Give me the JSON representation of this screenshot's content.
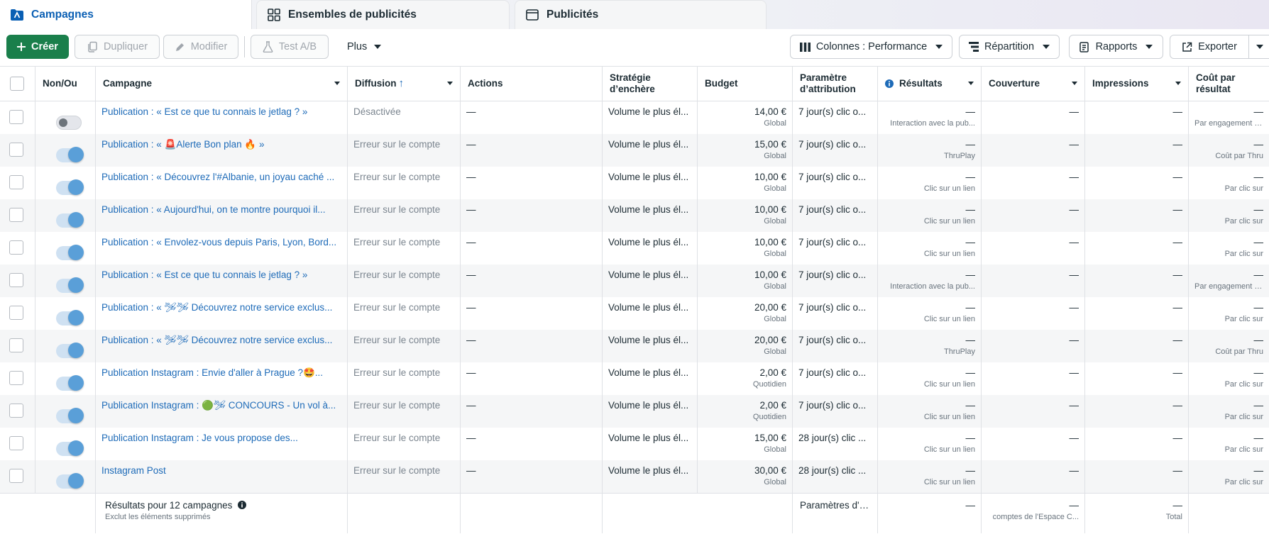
{
  "tabs": [
    {
      "label": "Campagnes",
      "icon": "folder-icon",
      "active": true
    },
    {
      "label": "Ensembles de publicités",
      "icon": "grid-icon",
      "active": false
    },
    {
      "label": "Publicités",
      "icon": "window-icon",
      "active": false
    }
  ],
  "toolbar": {
    "create": "Créer",
    "duplicate": "Dupliquer",
    "edit": "Modifier",
    "abtest": "Test A/B",
    "more": "Plus",
    "columns": "Colonnes : Performance",
    "breakdown": "Répartition",
    "reports": "Rapports",
    "export": "Exporter"
  },
  "headers": {
    "onoff": "Non/Ou",
    "campaign": "Campagne",
    "delivery": "Diffusion",
    "actions": "Actions",
    "bid": "Stratégie d’enchère",
    "budget": "Budget",
    "attribution": "Paramètre d’attribution",
    "results": "Résultats",
    "reach": "Couverture",
    "impressions": "Impressions",
    "cost": "Coût par résultat"
  },
  "rows": [
    {
      "on": false,
      "name": "Publication : « Est ce que tu connais le jetlag ? »",
      "delivery": "Désactivée",
      "actions": "—",
      "bid": "Volume le plus él...",
      "budget": "14,00 €",
      "budget_type": "Global",
      "attribution": "7 jour(s) clic o...",
      "results": "—",
      "result_type": "Interaction avec la pub...",
      "reach": "—",
      "impressions": "—",
      "cost": "—",
      "cost_type": "Par engagement ave"
    },
    {
      "on": true,
      "name": "Publication : « 🚨Alerte Bon plan 🔥 »",
      "delivery": "Erreur sur le compte",
      "actions": "—",
      "bid": "Volume le plus él...",
      "budget": "15,00 €",
      "budget_type": "Global",
      "attribution": "7 jour(s) clic o...",
      "results": "—",
      "result_type": "ThruPlay",
      "reach": "—",
      "impressions": "—",
      "cost": "—",
      "cost_type": "Coût par Thru"
    },
    {
      "on": true,
      "name": "Publication : « Découvrez l'#Albanie, un joyau caché ...",
      "delivery": "Erreur sur le compte",
      "actions": "—",
      "bid": "Volume le plus él...",
      "budget": "10,00 €",
      "budget_type": "Global",
      "attribution": "7 jour(s) clic o...",
      "results": "—",
      "result_type": "Clic sur un lien",
      "reach": "—",
      "impressions": "—",
      "cost": "—",
      "cost_type": "Par clic sur"
    },
    {
      "on": true,
      "name": "Publication : « Aujourd'hui, on te montre pourquoi il...",
      "delivery": "Erreur sur le compte",
      "actions": "—",
      "bid": "Volume le plus él...",
      "budget": "10,00 €",
      "budget_type": "Global",
      "attribution": "7 jour(s) clic o...",
      "results": "—",
      "result_type": "Clic sur un lien",
      "reach": "—",
      "impressions": "—",
      "cost": "—",
      "cost_type": "Par clic sur"
    },
    {
      "on": true,
      "name": "Publication : « Envolez-vous depuis Paris, Lyon, Bord...",
      "delivery": "Erreur sur le compte",
      "actions": "—",
      "bid": "Volume le plus él...",
      "budget": "10,00 €",
      "budget_type": "Global",
      "attribution": "7 jour(s) clic o...",
      "results": "—",
      "result_type": "Clic sur un lien",
      "reach": "—",
      "impressions": "—",
      "cost": "—",
      "cost_type": "Par clic sur"
    },
    {
      "on": true,
      "name": "Publication : « Est ce que tu connais le jetlag ? »",
      "delivery": "Erreur sur le compte",
      "actions": "—",
      "bid": "Volume le plus él...",
      "budget": "10,00 €",
      "budget_type": "Global",
      "attribution": "7 jour(s) clic o...",
      "results": "—",
      "result_type": "Interaction avec la pub...",
      "reach": "—",
      "impressions": "—",
      "cost": "—",
      "cost_type": "Par engagement ave"
    },
    {
      "on": true,
      "name": "Publication : « 🛩🛩 Découvrez notre service exclus...",
      "delivery": "Erreur sur le compte",
      "actions": "—",
      "bid": "Volume le plus él...",
      "budget": "20,00 €",
      "budget_type": "Global",
      "attribution": "7 jour(s) clic o...",
      "results": "—",
      "result_type": "Clic sur un lien",
      "reach": "—",
      "impressions": "—",
      "cost": "—",
      "cost_type": "Par clic sur"
    },
    {
      "on": true,
      "name": "Publication : « 🛩🛩 Découvrez notre service exclus...",
      "delivery": "Erreur sur le compte",
      "actions": "—",
      "bid": "Volume le plus él...",
      "budget": "20,00 €",
      "budget_type": "Global",
      "attribution": "7 jour(s) clic o...",
      "results": "—",
      "result_type": "ThruPlay",
      "reach": "—",
      "impressions": "—",
      "cost": "—",
      "cost_type": "Coût par Thru"
    },
    {
      "on": true,
      "name": "Publication Instagram : Envie d'aller à Prague ?🤩...",
      "delivery": "Erreur sur le compte",
      "actions": "—",
      "bid": "Volume le plus él...",
      "budget": "2,00 €",
      "budget_type": "Quotidien",
      "attribution": "7 jour(s) clic o...",
      "results": "—",
      "result_type": "Clic sur un lien",
      "reach": "—",
      "impressions": "—",
      "cost": "—",
      "cost_type": "Par clic sur"
    },
    {
      "on": true,
      "name": "Publication Instagram : 🟢🛩 CONCOURS - Un vol à...",
      "delivery": "Erreur sur le compte",
      "actions": "—",
      "bid": "Volume le plus él...",
      "budget": "2,00 €",
      "budget_type": "Quotidien",
      "attribution": "7 jour(s) clic o...",
      "results": "—",
      "result_type": "Clic sur un lien",
      "reach": "—",
      "impressions": "—",
      "cost": "—",
      "cost_type": "Par clic sur"
    },
    {
      "on": true,
      "name": "Publication Instagram : Je vous propose des...",
      "delivery": "Erreur sur le compte",
      "actions": "—",
      "bid": "Volume le plus él...",
      "budget": "15,00 €",
      "budget_type": "Global",
      "attribution": "28 jour(s) clic ...",
      "results": "—",
      "result_type": "Clic sur un lien",
      "reach": "—",
      "impressions": "—",
      "cost": "—",
      "cost_type": "Par clic sur"
    },
    {
      "on": true,
      "name": "Instagram Post",
      "delivery": "Erreur sur le compte",
      "actions": "—",
      "bid": "Volume le plus él...",
      "budget": "30,00 €",
      "budget_type": "Global",
      "attribution": "28 jour(s) clic ...",
      "results": "—",
      "result_type": "Clic sur un lien",
      "reach": "—",
      "impressions": "—",
      "cost": "—",
      "cost_type": "Par clic sur"
    }
  ],
  "footer": {
    "title": "Résultats pour 12 campagnes",
    "subtitle": "Exclut les éléments supprimés",
    "attribution": "Paramètres d'a...",
    "results": "—",
    "reach": "—",
    "reach_sub": "comptes de l'Espace C...",
    "impressions": "—",
    "impressions_sub": "Total"
  }
}
